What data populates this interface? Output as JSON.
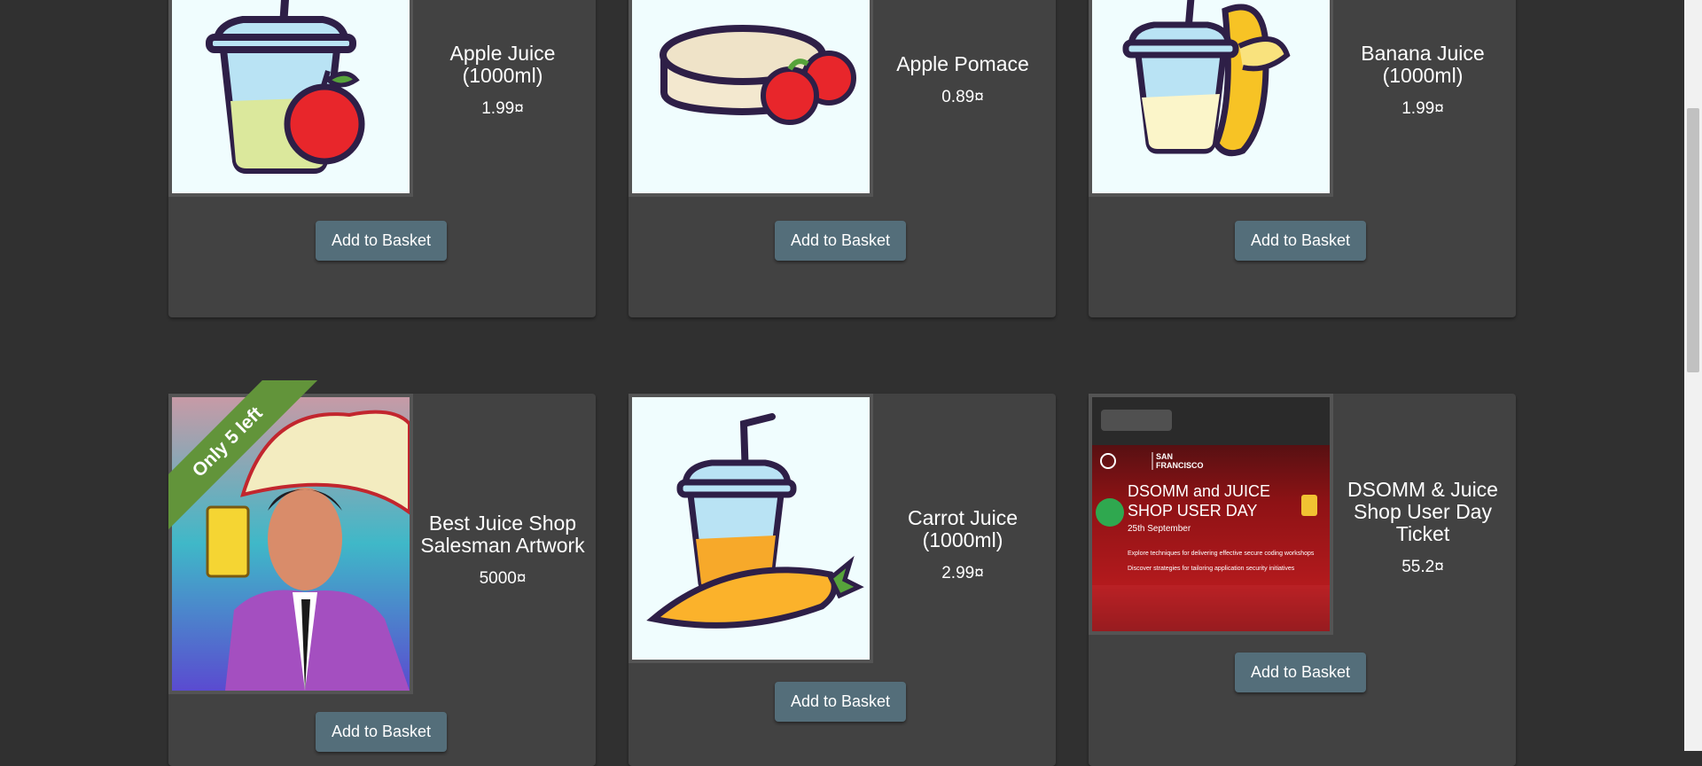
{
  "basket_label": "Add to Basket",
  "products": [
    {
      "name": "Apple Juice (1000ml)",
      "price": "1.99¤",
      "image": "apple-juice-cup-icon"
    },
    {
      "name": "Apple Pomace",
      "price": "0.89¤",
      "image": "apple-pomace-icon"
    },
    {
      "name": "Banana Juice (1000ml)",
      "price": "1.99¤",
      "image": "banana-juice-cup-icon"
    },
    {
      "name": "Best Juice Shop Salesman Artwork",
      "price": "5000¤",
      "image": "salesman-artwork",
      "ribbon": "Only 5 left"
    },
    {
      "name": "Carrot Juice (1000ml)",
      "price": "2.99¤",
      "image": "carrot-juice-cup-icon"
    },
    {
      "name": "DSOMM & Juice Shop User Day Ticket",
      "price": "55.2¤",
      "image": "event-poster",
      "poster": {
        "city": "SAN FRANCISCO",
        "headline_1": "DSOMM and JUICE",
        "headline_2": "SHOP USER DAY",
        "date": "25th September",
        "line_1": "Explore techniques for delivering effective secure coding workshops",
        "line_2": "Discover strategies for tailoring application security initiatives"
      }
    }
  ],
  "colors": {
    "page": "#303030",
    "card": "#424242",
    "button": "#546e7a",
    "ribbon": "#62943a"
  }
}
